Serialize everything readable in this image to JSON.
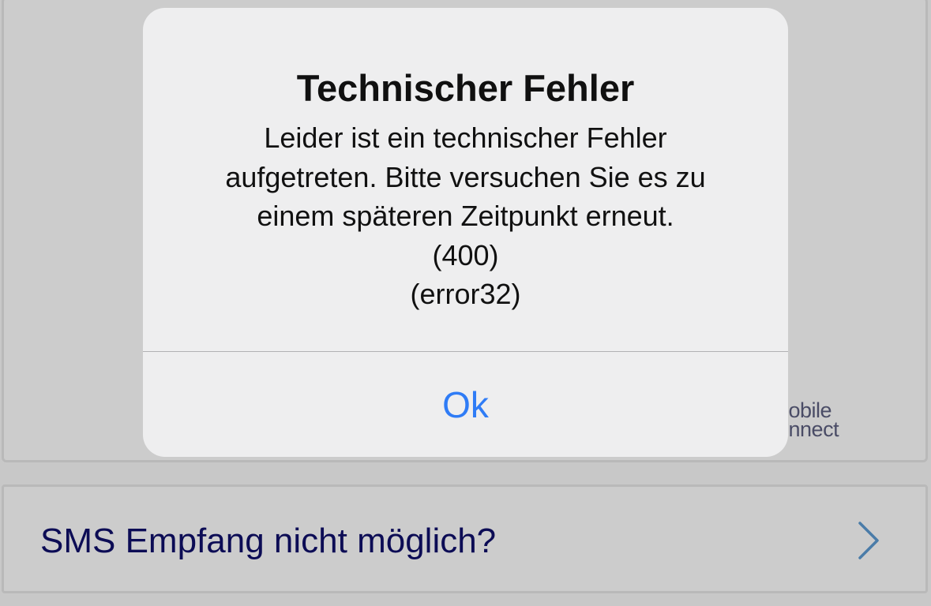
{
  "alert": {
    "title": "Technischer Fehler",
    "message_lines": [
      "Leider ist ein technischer Fehler",
      "aufgetreten. Bitte versuchen Sie es zu",
      "einem späteren Zeitpunkt erneut.",
      "(400)",
      "(error32)"
    ],
    "ok_label": "Ok"
  },
  "brand": {
    "line1": "nobile",
    "line2": "onnect"
  },
  "sms_help": {
    "label": "SMS Empfang nicht möglich?",
    "icon": "chevron-right-icon"
  },
  "colors": {
    "accent_blue": "#2f7cf6",
    "sms_text": "#0c0c55",
    "chevron": "#4a7ca8",
    "alert_bg": "#eeeeef",
    "background": "#c8c8c8"
  }
}
